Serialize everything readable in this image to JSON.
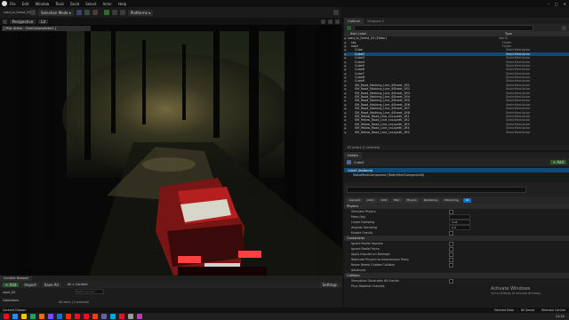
{
  "menu": [
    "File",
    "Edit",
    "Window",
    "Tools",
    "Build",
    "Select",
    "Actor",
    "Help"
  ],
  "window_title": "road_to_forest_03",
  "toolbar": {
    "mode_label": "Selection Mode",
    "platforms_label": "Platforms"
  },
  "viewport": {
    "label_perspective": "Perspective",
    "label_lit": "Lit",
    "pilot_text": "[ Pilot Active - CineCameraActor1 ]"
  },
  "outliner": {
    "tab": "Outliner",
    "tab2": "Viewport 2",
    "col_label": "Item Label",
    "col_type": "Type",
    "rows": [
      {
        "name": "road_to_forest_03 (Editor)",
        "type": "World"
      },
      {
        "name": "sky",
        "type": "Folder"
      },
      {
        "name": "road",
        "type": "Folder"
      },
      {
        "name": "Cube",
        "type": "StaticMeshActor"
      },
      {
        "name": "Cube2",
        "type": "StaticMeshActor",
        "sel": true
      },
      {
        "name": "Cube3",
        "type": "StaticMeshActor"
      },
      {
        "name": "Cube4",
        "type": "StaticMeshActor"
      },
      {
        "name": "Cube5",
        "type": "StaticMeshActor"
      },
      {
        "name": "Cube6",
        "type": "StaticMeshActor"
      },
      {
        "name": "Cube7",
        "type": "StaticMeshActor"
      },
      {
        "name": "Cube8",
        "type": "StaticMeshActor"
      },
      {
        "name": "Cube9",
        "type": "StaticMeshActor"
      },
      {
        "name": "SM_Road_Marking_Line_4Street_1R1",
        "type": "StaticMeshActor"
      },
      {
        "name": "SM_Road_Marking_Line_4Street_1R2",
        "type": "StaticMeshActor"
      },
      {
        "name": "SM_Road_Marking_Line_4Street_1R3",
        "type": "StaticMeshActor"
      },
      {
        "name": "SM_Road_Marking_Line_4Street_1R4",
        "type": "StaticMeshActor"
      },
      {
        "name": "SM_Road_Marking_Line_4Street_1R5",
        "type": "StaticMeshActor"
      },
      {
        "name": "SM_Road_Marking_Line_4Street_1R6",
        "type": "StaticMeshActor"
      },
      {
        "name": "SM_Road_Marking_Line_4Street_1R7",
        "type": "StaticMeshActor"
      },
      {
        "name": "SM_Road_Marking_Line_4Street_1R8",
        "type": "StaticMeshActor"
      },
      {
        "name": "SM_Yellow_Road_Line_cxLayeth_1R1",
        "type": "StaticMeshActor"
      },
      {
        "name": "SM_Yellow_Road_Line_cxLayeth_1R2",
        "type": "StaticMeshActor"
      },
      {
        "name": "SM_Yellow_Road_Line_cxLayeth_1R3",
        "type": "StaticMeshActor"
      },
      {
        "name": "SM_Yellow_Road_Line_cxLayeth_1R4",
        "type": "StaticMeshActor"
      },
      {
        "name": "SM_Yellow_Road_Line_cxLayeth_1R5",
        "type": "StaticMeshActor"
      }
    ],
    "footer": "81 actors (1 selected)"
  },
  "details": {
    "tab": "Details",
    "actor_name": "Cube2",
    "add_label": "+ Add",
    "component_root": "Cube2 (Instance)",
    "component_child": "StaticMeshComponent (StaticMeshComponent0)",
    "categories": [
      "General",
      "Actor",
      "LOD",
      "Misc",
      "Physics",
      "Rendering",
      "Streaming",
      "All"
    ],
    "sections": [
      {
        "title": "Physics",
        "props": [
          {
            "label": "Simulate Physics",
            "kind": "chk"
          },
          {
            "label": "Mass (kg)",
            "kind": "val",
            "value": ""
          },
          {
            "label": "Linear Damping",
            "kind": "val",
            "value": "0.01"
          },
          {
            "label": "Angular Damping",
            "kind": "val",
            "value": "0.0"
          },
          {
            "label": "Enable Gravity",
            "kind": "chk"
          }
        ]
      },
      {
        "title": "Constraints",
        "props": [
          {
            "label": "Ignore Radial Impulse",
            "kind": "chk"
          },
          {
            "label": "Ignore Radial Force",
            "kind": "chk"
          },
          {
            "label": "Apply Impulse on Damage",
            "kind": "chk"
          },
          {
            "label": "Replicate Physics to Autonomous Proxy",
            "kind": "chk"
          },
          {
            "label": "Never Needs Cooked Collision",
            "kind": "chk"
          },
          {
            "label": "Advanced",
            "kind": "none"
          }
        ]
      },
      {
        "title": "Collision",
        "props": [
          {
            "label": "Simulation Generates Hit Events",
            "kind": "chk"
          },
          {
            "label": "Phys Material Override",
            "kind": "none"
          }
        ]
      }
    ],
    "watermark_title": "Activate Windows",
    "watermark_sub": "Go to Settings to activate Windows."
  },
  "content_browser": {
    "tab": "Content Browser",
    "add_label": "+ Add",
    "import_label": "Import",
    "save_label": "Save All",
    "path": "All > Content",
    "settings_label": "Settings",
    "search_placeholder": "Search Content",
    "folder": "none_03",
    "collections": "Collections",
    "status": "68 items (1 selected)"
  },
  "status_bar": {
    "left": "Content Drawer",
    "right_1": "Derived Data",
    "right_2": "All Saved",
    "right_3": "Revision Control"
  },
  "taskbar": {
    "time": "11:22",
    "icon_colors": [
      "#e81123",
      "#1e90ff",
      "#f7c600",
      "#1aa260",
      "#ff6a00",
      "#7a4dff",
      "#0078d4",
      "#d83b01",
      "#e81123",
      "#e81123",
      "#ff3d00",
      "#6264a7",
      "#00a4ef",
      "#e81123",
      "#999999",
      "#c239b3"
    ]
  }
}
